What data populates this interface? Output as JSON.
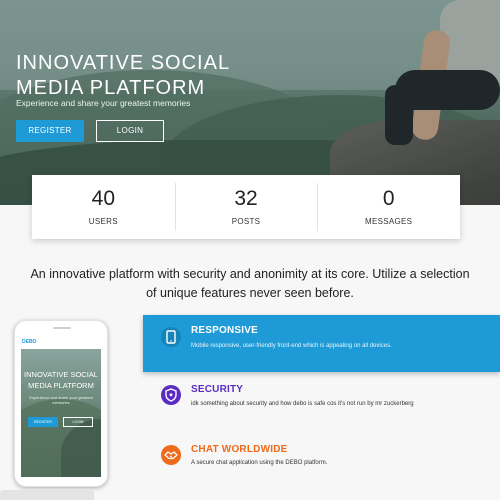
{
  "hero": {
    "title": "INNOVATIVE SOCIAL MEDIA PLATFORM",
    "subtitle": "Experience and share your greatest memories",
    "register_label": "REGISTER",
    "login_label": "LOGIN"
  },
  "stats": [
    {
      "value": "40",
      "label": "USERS"
    },
    {
      "value": "32",
      "label": "POSTS"
    },
    {
      "value": "0",
      "label": "MESSAGES"
    }
  ],
  "intro": "An innovative platform with security and anonimity at its core. Utilize a selection of unique features never seen before.",
  "phone": {
    "brand": "DEBO",
    "title": "INNOVATIVE SOCIAL MEDIA PLATFORM",
    "subtitle": "Experience and share your greatest memories",
    "register_label": "REGISTER",
    "login_label": "LOGIN"
  },
  "features": [
    {
      "title": "RESPONSIVE",
      "description": "Mobile responsive, user-friendly front-end which is appealing on all devices.",
      "icon": "tablet-icon"
    },
    {
      "title": "SECURITY",
      "description": "idk something about security and how debo is safe cos it's not run by mr zuckerberg",
      "icon": "shield-icon"
    },
    {
      "title": "CHAT WORLDWIDE",
      "description": "A secure chat application using the DEBO platform.",
      "icon": "handshake-icon"
    }
  ],
  "colors": {
    "primary": "#1e9ad6",
    "security": "#5b2cc2",
    "chat": "#ee6a1d"
  }
}
